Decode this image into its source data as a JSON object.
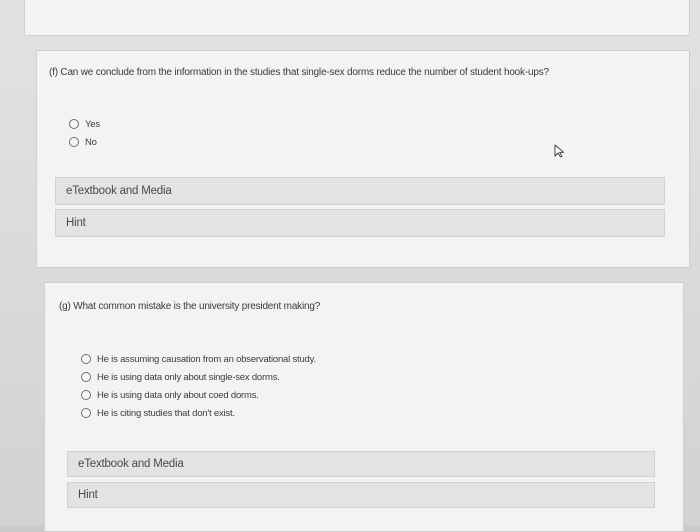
{
  "question_f": {
    "text": "(f) Can we conclude from the information in the studies that single-sex dorms reduce the number of student hook-ups?",
    "options": [
      "Yes",
      "No"
    ],
    "etextbook_label": "eTextbook and Media",
    "hint_label": "Hint"
  },
  "question_g": {
    "text": "(g) What common mistake is the university president making?",
    "options": [
      "He is assuming causation from an observational study.",
      "He is using data only about single-sex dorms.",
      "He is using data only about coed dorms.",
      "He is citing studies that don't exist."
    ],
    "etextbook_label": "eTextbook and Media",
    "hint_label": "Hint"
  },
  "icons": {
    "cursor": "mouse-pointer-icon"
  }
}
